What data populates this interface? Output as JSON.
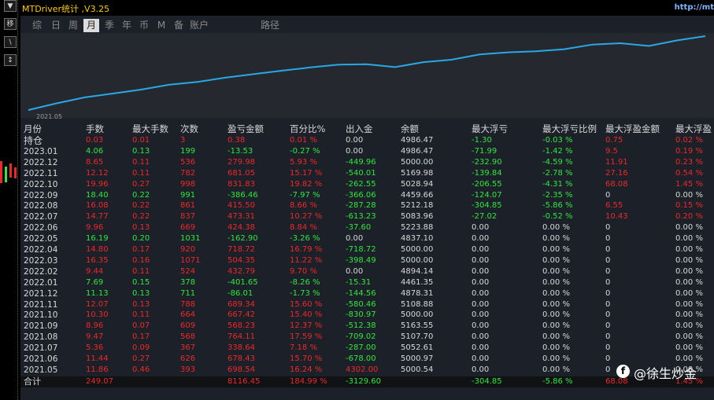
{
  "window": {
    "title": "MTDriver统计 ,V3.25",
    "url_text": "http://mt"
  },
  "sidebar": {
    "buttons": [
      "▼",
      "移",
      "\\",
      "↕"
    ]
  },
  "tabs": [
    {
      "label": "综",
      "selected": false
    },
    {
      "label": "日",
      "selected": false
    },
    {
      "label": "周",
      "selected": false
    },
    {
      "label": "月",
      "selected": true
    },
    {
      "label": "季",
      "selected": false
    },
    {
      "label": "年",
      "selected": false
    },
    {
      "label": "币",
      "selected": false
    },
    {
      "label": "M",
      "selected": false
    },
    {
      "label": "备",
      "selected": false
    },
    {
      "label": "账户",
      "selected": false
    },
    {
      "label": "路径",
      "selected": false
    }
  ],
  "chart_data": {
    "type": "line",
    "series": [
      {
        "values": [
          4500,
          4690,
          4860,
          4970,
          5080,
          5220,
          5300,
          5420,
          5520,
          5620,
          5710,
          5790,
          5800,
          5720,
          5860,
          5930,
          6080,
          6140,
          6170,
          6230,
          6360,
          6400,
          6320,
          6480,
          6600
        ]
      }
    ],
    "xlabel_start": "2021.05",
    "color": "#29a8e8"
  },
  "table": {
    "columns": [
      "月份",
      "手数",
      "最大手数",
      "次数",
      "盈亏金额",
      "百分比%",
      "出入金",
      "余额",
      "最大浮亏",
      "最大浮亏比例",
      "最大浮盈金额",
      "最大浮盈"
    ],
    "rows": [
      {
        "month": "持仓",
        "c": "r",
        "cells": [
          "0.03",
          "0.01",
          "3",
          "0.38",
          "0.01 %",
          "0.00",
          "4986.47",
          "-1.30",
          "-0.03 %",
          "0.75",
          "0.02 %"
        ]
      },
      {
        "month": "2023.01",
        "c": "g",
        "cells": [
          "4.06",
          "0.13",
          "199",
          "-13.53",
          "-0.27 %",
          "0.00",
          "4986.47",
          "-71.99",
          "-1.42 %",
          "9.5",
          "0.19 %"
        ]
      },
      {
        "month": "2022.12",
        "c": "r",
        "cells": [
          "8.65",
          "0.11",
          "536",
          "279.98",
          "5.93 %",
          "-449.96",
          "5000.00",
          "-232.90",
          "-4.59 %",
          "11.91",
          "0.23 %"
        ]
      },
      {
        "month": "2022.11",
        "c": "r",
        "cells": [
          "12.12",
          "0.11",
          "782",
          "681.05",
          "15.17 %",
          "-540.01",
          "5169.98",
          "-139.84",
          "-2.78 %",
          "27.16",
          "0.54 %"
        ]
      },
      {
        "month": "2022.10",
        "c": "r",
        "cells": [
          "19.96",
          "0.27",
          "998",
          "831.83",
          "19.82 %",
          "-262.55",
          "5028.94",
          "-206.55",
          "-4.31 %",
          "68.08",
          "1.45 %"
        ]
      },
      {
        "month": "2022.09",
        "c": "g",
        "cells": [
          "18.40",
          "0.22",
          "991",
          "-386.46",
          "-7.97 %",
          "-366.06",
          "4459.66",
          "-124.07",
          "-2.35 %",
          "0",
          "0.00 %"
        ]
      },
      {
        "month": "2022.08",
        "c": "r",
        "cells": [
          "16.08",
          "0.22",
          "861",
          "415.50",
          "8.66 %",
          "-287.28",
          "5212.18",
          "-304.85",
          "-5.86 %",
          "6.55",
          "0.15 %"
        ]
      },
      {
        "month": "2022.07",
        "c": "r",
        "cells": [
          "14.77",
          "0.22",
          "837",
          "473.31",
          "10.27 %",
          "-613.23",
          "5083.96",
          "-27.02",
          "-0.52 %",
          "10.43",
          "0.20 %"
        ]
      },
      {
        "month": "2022.06",
        "c": "r",
        "cells": [
          "9.96",
          "0.13",
          "669",
          "424.38",
          "8.84 %",
          "-37.60",
          "5223.88",
          "0.00",
          "0.00 %",
          "0",
          "0.00 %"
        ]
      },
      {
        "month": "2022.05",
        "c": "g",
        "cells": [
          "16.19",
          "0.20",
          "1031",
          "-162.90",
          "-3.26 %",
          "0.00",
          "4837.10",
          "0.00",
          "0.00 %",
          "0",
          "0.00 %"
        ]
      },
      {
        "month": "2022.04",
        "c": "r",
        "cells": [
          "14.80",
          "0.17",
          "920",
          "718.72",
          "16.79 %",
          "-718.72",
          "5000.00",
          "0.00",
          "0.00 %",
          "0",
          "0.00 %"
        ]
      },
      {
        "month": "2022.03",
        "c": "r",
        "cells": [
          "16.35",
          "0.16",
          "1071",
          "504.35",
          "11.22 %",
          "-398.49",
          "5000.00",
          "0.00",
          "0.00 %",
          "0",
          "0.00 %"
        ]
      },
      {
        "month": "2022.02",
        "c": "r",
        "cells": [
          "9.44",
          "0.11",
          "524",
          "432.79",
          "9.70 %",
          "0.00",
          "4894.14",
          "0.00",
          "0.00 %",
          "0",
          "0.00 %"
        ]
      },
      {
        "month": "2022.01",
        "c": "g",
        "cells": [
          "7.69",
          "0.15",
          "378",
          "-401.65",
          "-8.26 %",
          "-15.31",
          "4461.35",
          "0.00",
          "0.00 %",
          "0",
          "0.00 %"
        ]
      },
      {
        "month": "2021.12",
        "c": "g",
        "cells": [
          "11.13",
          "0.13",
          "711",
          "-86.01",
          "-1.73 %",
          "-144.56",
          "4878.31",
          "0.00",
          "0.00 %",
          "0",
          "0.00 %"
        ]
      },
      {
        "month": "2021.11",
        "c": "r",
        "cells": [
          "12.07",
          "0.13",
          "788",
          "689.34",
          "15.60 %",
          "-580.46",
          "5108.88",
          "0.00",
          "0.00 %",
          "0",
          "0.00 %"
        ]
      },
      {
        "month": "2021.10",
        "c": "r",
        "cells": [
          "10.30",
          "0.11",
          "664",
          "667.42",
          "15.40 %",
          "-830.97",
          "5000.00",
          "0.00",
          "0.00 %",
          "0",
          "0.00 %"
        ]
      },
      {
        "month": "2021.09",
        "c": "r",
        "cells": [
          "8.96",
          "0.07",
          "609",
          "568.23",
          "12.37 %",
          "-512.38",
          "5163.55",
          "0.00",
          "0.00 %",
          "0",
          "0.00 %"
        ]
      },
      {
        "month": "2021.08",
        "c": "r",
        "cells": [
          "9.47",
          "0.17",
          "568",
          "764.11",
          "17.59 %",
          "-709.02",
          "5107.70",
          "0.00",
          "0.00 %",
          "0",
          "0.00 %"
        ]
      },
      {
        "month": "2021.07",
        "c": "r",
        "cells": [
          "5.36",
          "0.09",
          "367",
          "338.64",
          "7.18 %",
          "-287.00",
          "5052.61",
          "0.00",
          "0.00 %",
          "0",
          "0.00 %"
        ]
      },
      {
        "month": "2021.06",
        "c": "r",
        "cells": [
          "11.44",
          "0.27",
          "626",
          "678.43",
          "15.70 %",
          "-678.00",
          "5000.97",
          "0.00",
          "0.00 %",
          "0",
          "0.00 %"
        ]
      },
      {
        "month": "2021.05",
        "c": "r",
        "cells": [
          "11.86",
          "0.46",
          "393",
          "698.54",
          "16.24 %",
          "4302.00",
          "5000.54",
          "0.00",
          "0.00 %",
          "0",
          "0.00 %"
        ]
      }
    ],
    "total": {
      "month": "合计",
      "cells": [
        "249.07",
        "",
        "",
        "8116.45",
        "184.99 %",
        "-3129.60",
        "",
        "-304.85",
        "-5.86 %",
        "68.08",
        "1.45 %"
      ]
    }
  },
  "watermark": {
    "icon": "f",
    "text": "@徐生炒金"
  },
  "colors": {
    "profit": "#ee2828",
    "loss": "#2ee83c",
    "title": "#ffcc00",
    "curve": "#29a8e8"
  }
}
